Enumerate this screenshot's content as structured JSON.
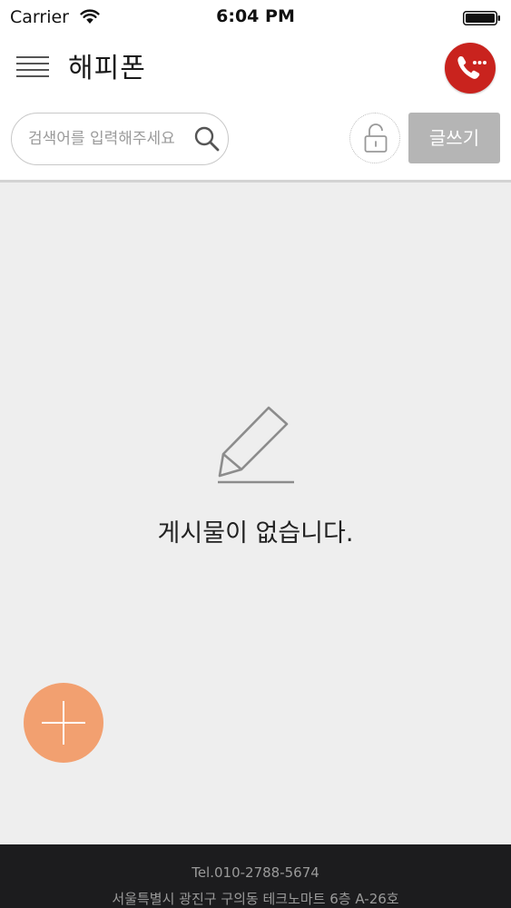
{
  "status_bar": {
    "carrier": "Carrier",
    "time": "6:04 PM",
    "icons": [
      "wifi-icon",
      "battery-icon"
    ]
  },
  "header": {
    "title": "해피폰",
    "menu_icon": "hamburger-menu-icon",
    "call_icon": "phone-call-icon",
    "call_button_color": "#c9231e"
  },
  "toolbar": {
    "search_placeholder": "검색어를 입력해주세요",
    "search_value": "",
    "search_icon": "search-icon",
    "lock_icon": "unlocked-padlock-icon",
    "write_label": "글쓰기",
    "write_button_color": "#b5b5b5"
  },
  "content": {
    "empty_icon": "pencil-icon",
    "empty_message": "게시물이 없습니다.",
    "fab_icon": "plus-icon",
    "fab_color": "#f2a070",
    "background": "#eeeeee"
  },
  "footer": {
    "tel": "Tel.010-2788-5674",
    "address": "서울특별시 광진구 구의동 테크노마트 6층 A-26호"
  }
}
